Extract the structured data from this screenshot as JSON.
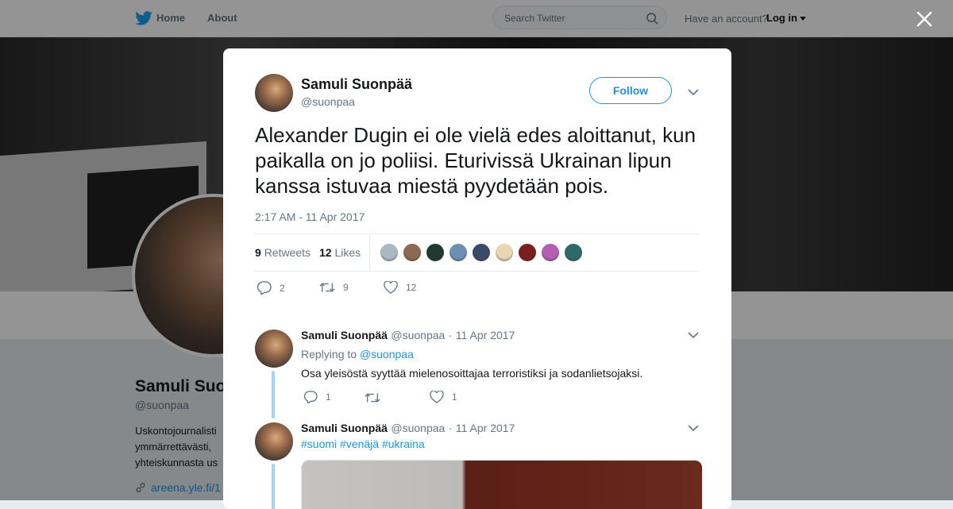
{
  "topnav": {
    "home_label": "Home",
    "about_label": "About",
    "search_placeholder": "Search Twitter",
    "have_account": "Have an account?",
    "login_label": "Log in"
  },
  "profile": {
    "name": "Samuli Suonpää",
    "handle": "@suonpaa",
    "bio": "Uskontojournalisti ymmärrettävästi, yhteiskunnasta us",
    "link": "areena.yle.fi/1"
  },
  "modal": {
    "close_icon": "close-icon",
    "author_name": "Samuli Suonpää",
    "author_handle": "@suonpaa",
    "follow_label": "Follow",
    "text": "Alexander Dugin ei ole vielä edes aloittanut, kun paikalla on jo poliisi. Eturivissä Ukrainan lipun kanssa istuvaa miestä pyydetään pois.",
    "timestamp": "2:17 AM - 11 Apr 2017",
    "retweets_count": "9",
    "retweets_label": "Retweets",
    "likes_count": "12",
    "likes_label": "Likes",
    "actions": {
      "replies": "2",
      "retweets": "9",
      "likes": "12"
    },
    "likers_colors": [
      "#aab8c2",
      "#8a6a55",
      "#1f3a2e",
      "#6c8fb3",
      "#3a4b6a",
      "#e8d7b0",
      "#7a1f1f",
      "#b45fb3",
      "#2f6a6a"
    ]
  },
  "replies": [
    {
      "name": "Samuli Suonpää",
      "handle": "@suonpaa",
      "date": "11 Apr 2017",
      "replying_prefix": "Replying to",
      "replying_to": "@suonpaa",
      "text": "Osa yleisöstä syyttää mielenosoittajaa terroristiksi ja sodanlietsojaksi.",
      "reply_count": "1",
      "retweet_count": "",
      "like_count": "1"
    },
    {
      "name": "Samuli Suonpää",
      "handle": "@suonpaa",
      "date": "11 Apr 2017",
      "hashtags": [
        "#suomi",
        "#venäjä",
        "#ukraina"
      ]
    }
  ],
  "colors": {
    "accent": "#1b95e0",
    "thread_line": "#a6d3ef",
    "muted": "#657786"
  }
}
